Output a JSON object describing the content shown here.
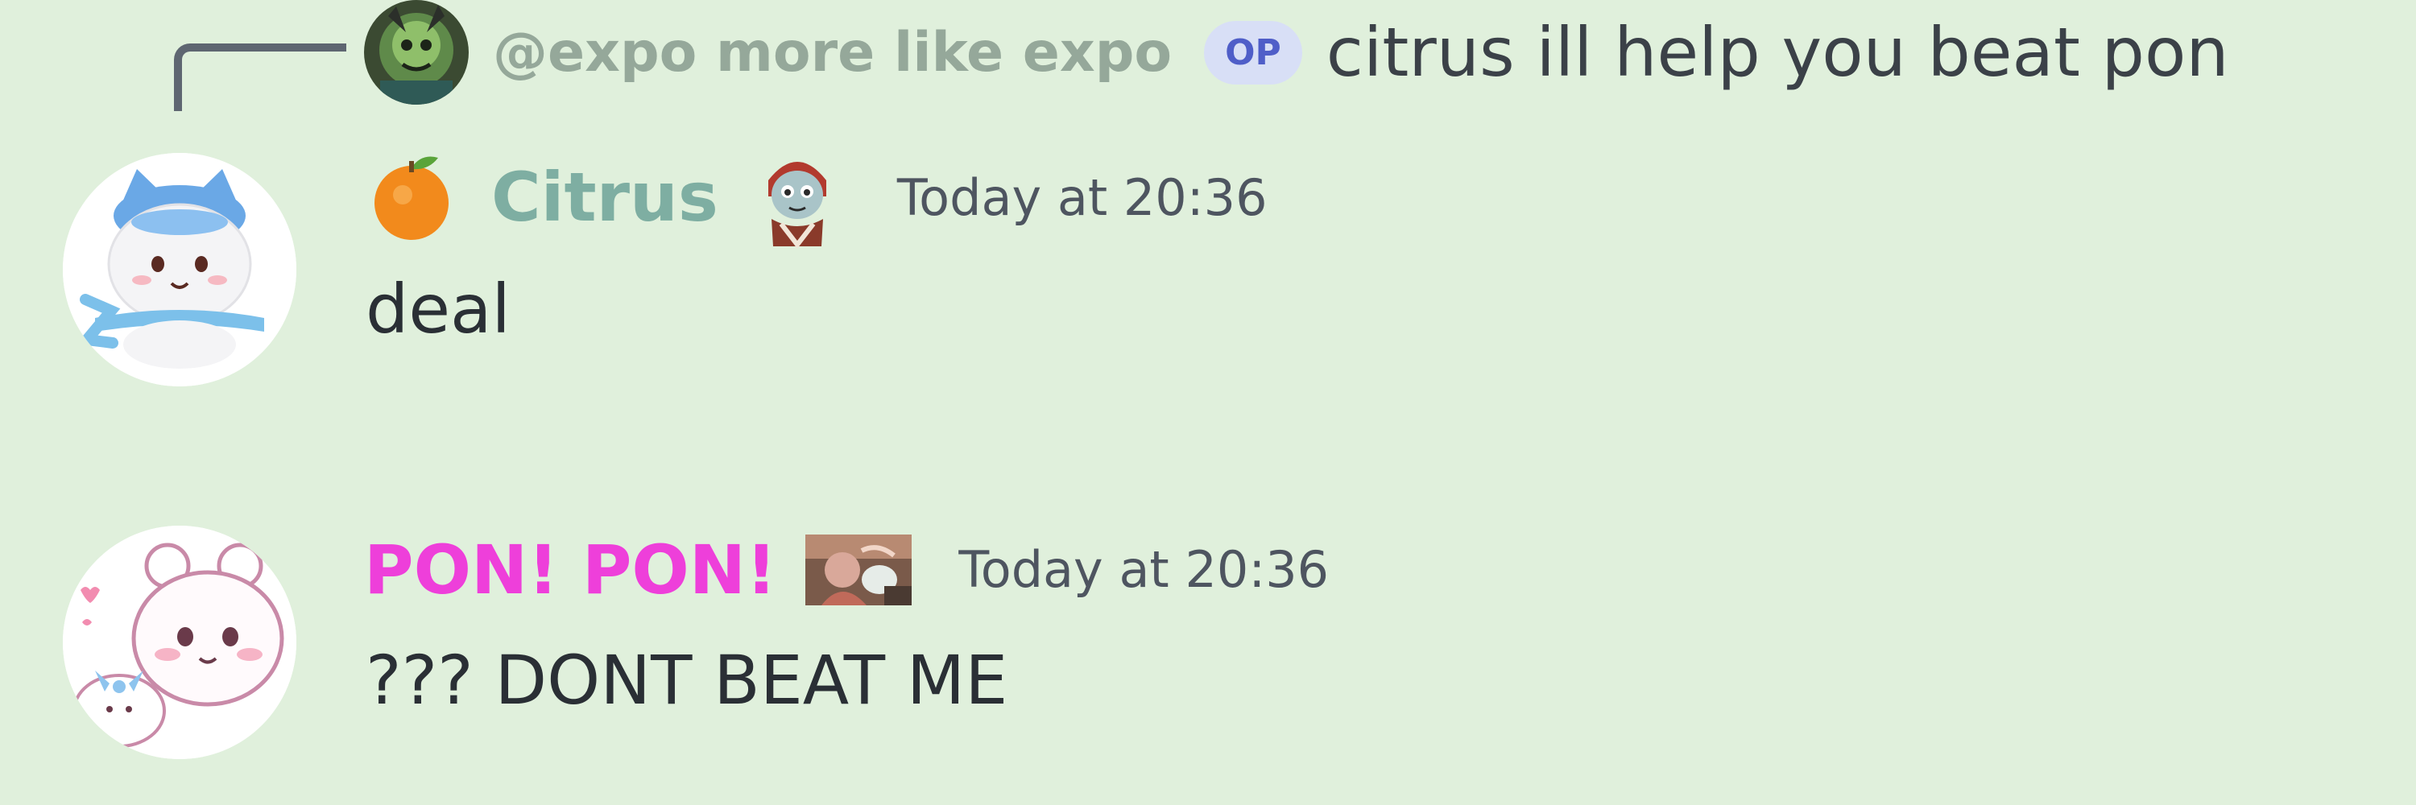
{
  "reply": {
    "author": "@expo more like expo",
    "badge": "OP",
    "content": "citrus ill help you beat pon"
  },
  "messages": [
    {
      "username": "Citrus",
      "username_color": "#7eaea2",
      "prefix_emoji": "tangerine-icon",
      "role_icon": "character-role-icon",
      "timestamp": "Today at 20:36",
      "text": "deal"
    },
    {
      "username": "PON! PON!",
      "username_color": "#ee3fda",
      "role_icon": "photo-role-icon",
      "timestamp": "Today at 20:36",
      "text": "??? DONT BEAT ME"
    }
  ],
  "colors": {
    "background": "#e0f0dc",
    "reply_spine": "#5e6671",
    "op_badge_bg": "#d8dff6",
    "op_badge_text": "#4f5ec8"
  }
}
